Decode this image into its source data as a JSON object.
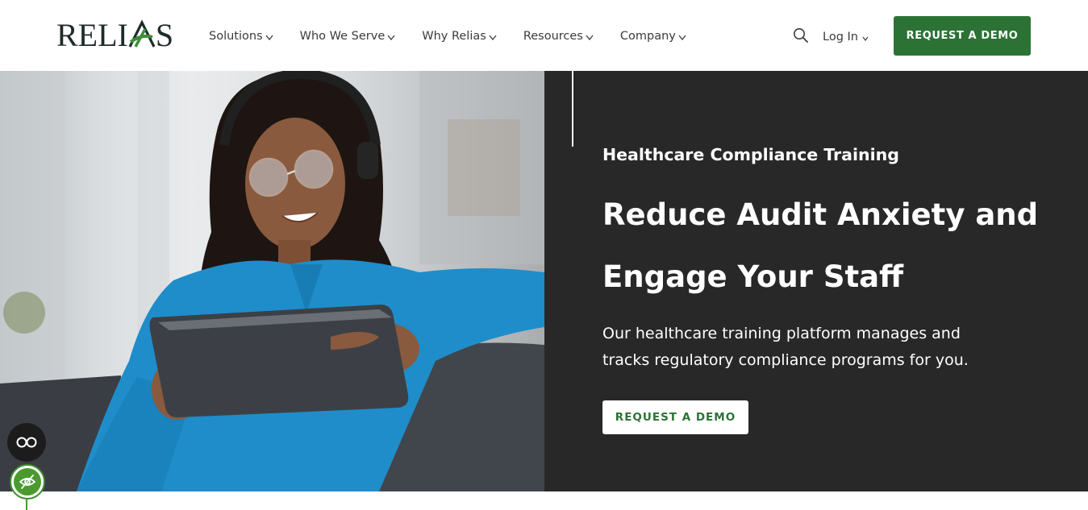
{
  "header": {
    "logo_text_left": "RELI",
    "logo_text_right": "S",
    "logo_text_full": "RELIAS",
    "nav": [
      {
        "label": "Solutions"
      },
      {
        "label": "Who We Serve"
      },
      {
        "label": "Why Relias"
      },
      {
        "label": "Resources"
      },
      {
        "label": "Company"
      }
    ],
    "search_icon": "search-icon",
    "login_label": "Log In",
    "demo_label": "REQUEST A DEMO"
  },
  "hero": {
    "eyebrow": "Healthcare Compliance Training",
    "headline_line1": "Reduce Audit Anxiety and",
    "headline_line2": "Engage Your Staff",
    "subtext_line1": "Our healthcare training platform manages and",
    "subtext_line2": "tracks regulatory compliance programs for you.",
    "demo_label": "REQUEST A DEMO",
    "image_description_icon": "photo-woman-with-tablet"
  },
  "widgets": {
    "captions_icon": "closed-captions-icon",
    "accessibility_icon": "eye-off-icon"
  },
  "colors": {
    "brand_green": "#2c7235",
    "hero_panel": "#282828",
    "logo_dark": "#1f2a2c",
    "nav_text": "#3b3b3b"
  }
}
